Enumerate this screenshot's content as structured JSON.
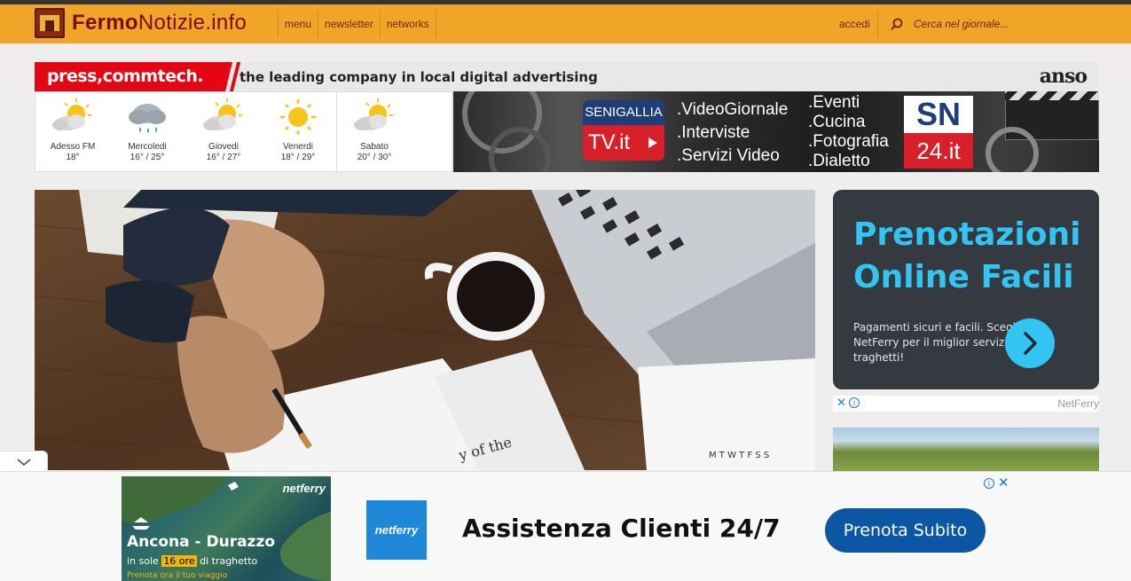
{
  "header": {
    "logo_bold": "Fermo",
    "logo_light": "Notizie.info",
    "nav": [
      "menu",
      "newsletter",
      "networks"
    ],
    "login_label": "accedi",
    "search_placeholder": "Cerca nel giornale..."
  },
  "banner": {
    "brand": "press,commtech.",
    "tagline": "the leading company in local digital advertising",
    "partner": "anso"
  },
  "weather": [
    {
      "day": "Adesso FM",
      "temp": "18°",
      "icon": "partly-cloudy-icon"
    },
    {
      "day": "Mercoledi",
      "temp": "16° / 25°",
      "icon": "rain-icon"
    },
    {
      "day": "Giovedi",
      "temp": "16° / 27°",
      "icon": "partly-cloudy-icon"
    },
    {
      "day": "Venerdi",
      "temp": "18° / 29°",
      "icon": "sun-icon"
    },
    {
      "day": "Sabato",
      "temp": "20° / 30°",
      "icon": "partly-cloudy-icon"
    }
  ],
  "tv_ad": {
    "logo_top": "SENIGALLIA",
    "logo_bottom": "TV.it",
    "list1": [
      ".VideoGiornale",
      ".Interviste",
      ".Servizi Video"
    ],
    "list2": [
      ".Eventi",
      ".Cucina",
      ".Fotografia",
      ".Dialetto"
    ],
    "sn_top": "SN",
    "sn_bottom": "24.it"
  },
  "side_ad": {
    "title": "Prenotazioni Online Facili",
    "description": "Pagamenti sicuri e facili. Scegli NetFerry per il miglior servizio traghetti!",
    "brand": "NetFerry"
  },
  "bottom_ad": {
    "image_brand": "netferry",
    "route": "Ancona - Durazzo",
    "sub_prefix": "in sole ",
    "sub_highlight": "16 ore",
    "sub_suffix": " di traghetto",
    "image_cta": "Prenota ora il tuo viaggio",
    "logo": "netferry",
    "headline": "Assistenza Clienti 24/7",
    "button": "Prenota Subito"
  },
  "colors": {
    "header_bg": "#f0a428",
    "logo_red": "#7a0d0d",
    "press_red": "#e30613",
    "ad_cyan": "#32c5f4",
    "ad_dark": "#343a40",
    "button_blue": "#0b57a4"
  }
}
